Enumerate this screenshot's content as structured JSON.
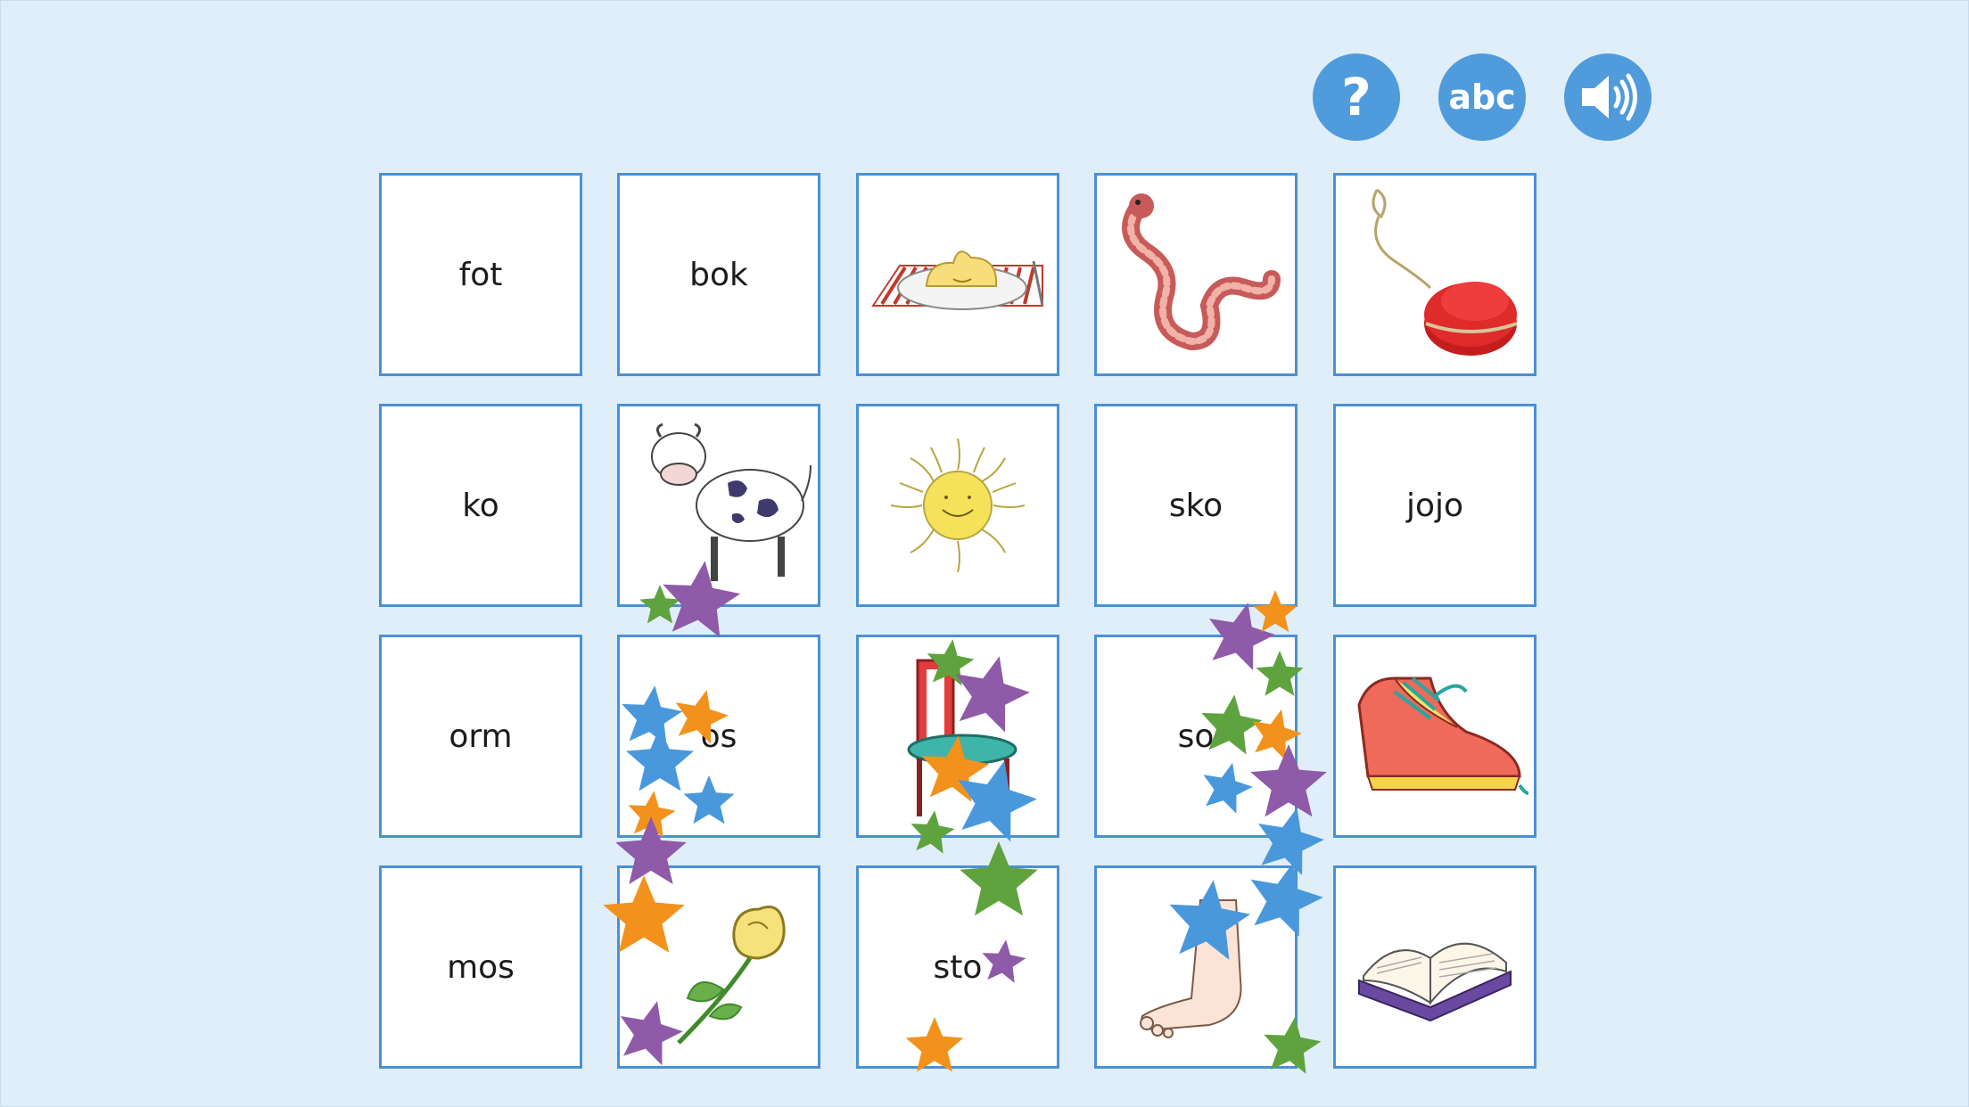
{
  "toolbar": {
    "help_glyph": "?",
    "abc_label": "abc",
    "help_icon": "question-icon",
    "abc_icon": "abc-icon",
    "sound_icon": "speaker-icon",
    "button_color": "#4f9bdc"
  },
  "cards": [
    {
      "type": "word",
      "text": "fot"
    },
    {
      "type": "word",
      "text": "bok"
    },
    {
      "type": "picture",
      "icon": "mashed-potatoes-plate"
    },
    {
      "type": "picture",
      "icon": "worm"
    },
    {
      "type": "picture",
      "icon": "yoyo"
    },
    {
      "type": "word",
      "text": "ko"
    },
    {
      "type": "picture",
      "icon": "cow"
    },
    {
      "type": "picture",
      "icon": "sun"
    },
    {
      "type": "word",
      "text": "sko"
    },
    {
      "type": "word",
      "text": "jojo"
    },
    {
      "type": "word",
      "text": "orm"
    },
    {
      "type": "word",
      "text": "os"
    },
    {
      "type": "picture",
      "icon": "chair"
    },
    {
      "type": "word",
      "text": "so"
    },
    {
      "type": "picture",
      "icon": "shoe"
    },
    {
      "type": "word",
      "text": "mos"
    },
    {
      "type": "picture",
      "icon": "rose"
    },
    {
      "type": "word",
      "text": "sto"
    },
    {
      "type": "picture",
      "icon": "foot"
    },
    {
      "type": "picture",
      "icon": "book"
    }
  ],
  "colors": {
    "background": "#dfeef9",
    "card_border": "#4a90d6",
    "star_purple": "#8f5aa8",
    "star_green": "#5ea33e",
    "star_orange": "#f2921c",
    "star_blue": "#4a98dc"
  }
}
